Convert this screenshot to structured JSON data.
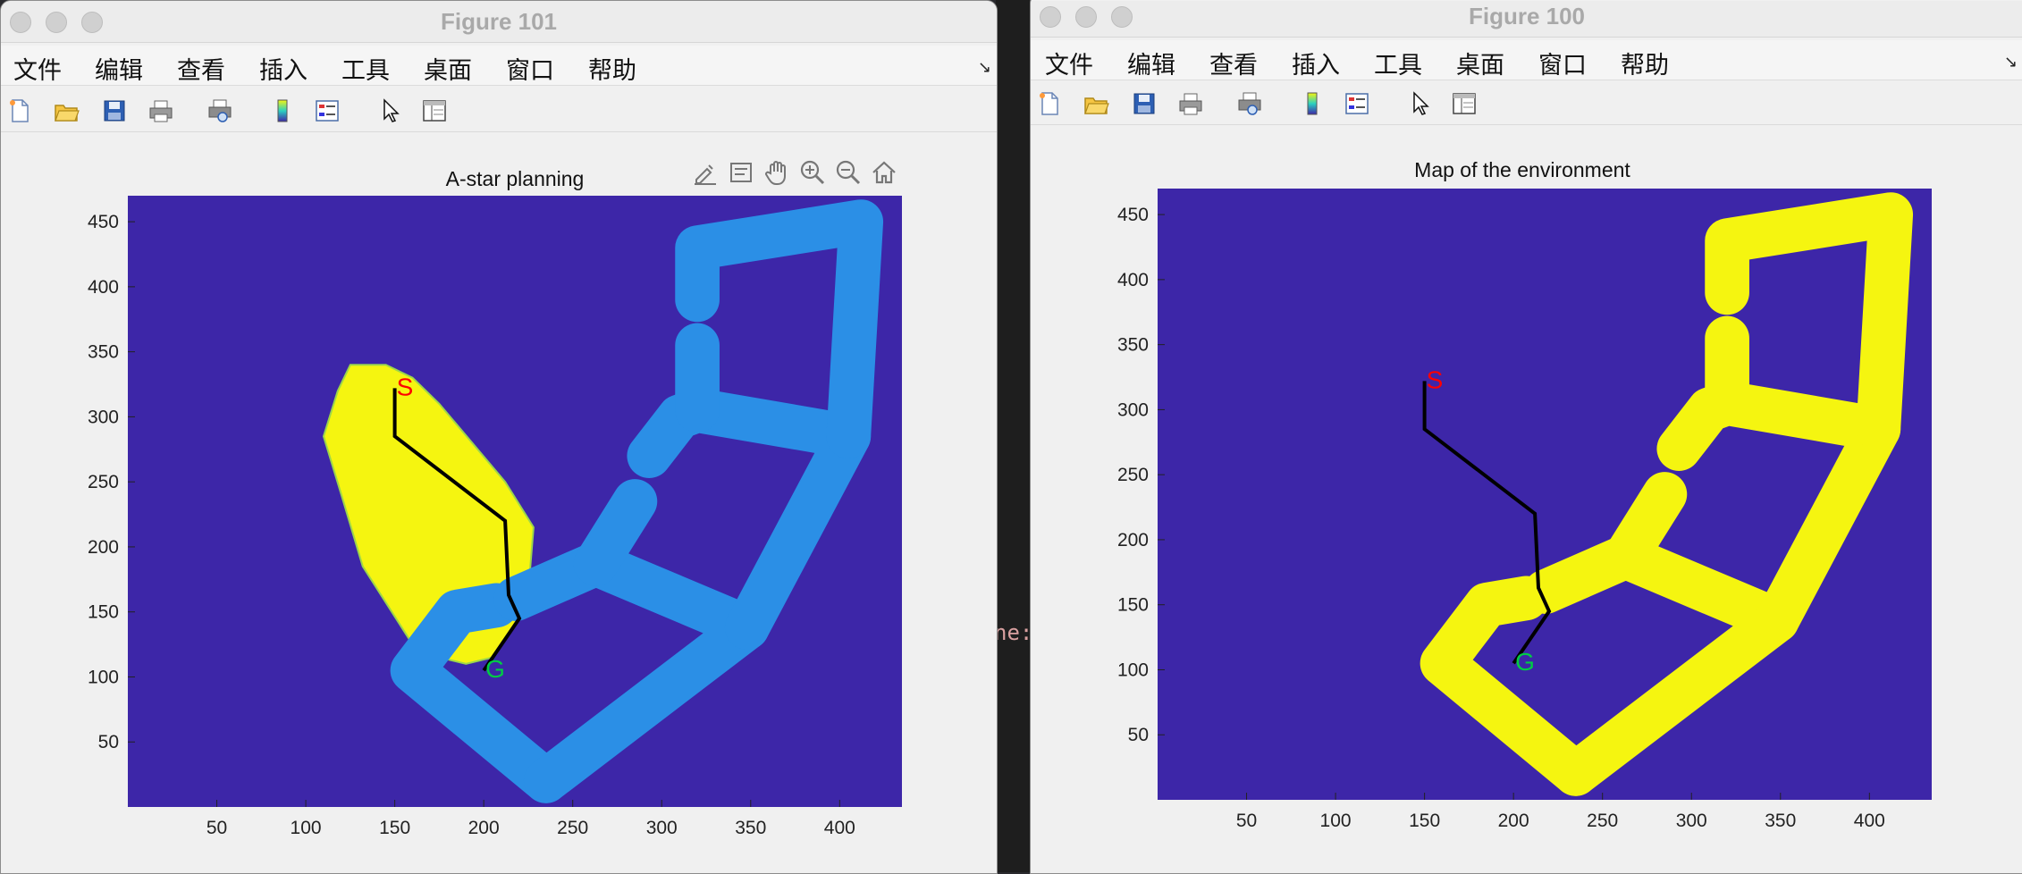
{
  "background": {
    "terminal_fragment": "ne:"
  },
  "windows": [
    {
      "id": "w101",
      "title": "Figure 101",
      "menu": [
        "文件",
        "编辑",
        "查看",
        "插入",
        "工具",
        "桌面",
        "窗口",
        "帮助"
      ],
      "chart_title": "A-star planning",
      "axes_tools": [
        "brush-icon",
        "datatip-icon",
        "pan-icon",
        "zoom-in-icon",
        "zoom-out-icon",
        "home-icon"
      ]
    },
    {
      "id": "w100",
      "title": "Figure 100",
      "menu": [
        "文件",
        "编辑",
        "查看",
        "插入",
        "工具",
        "桌面",
        "窗口",
        "帮助"
      ],
      "chart_title": "Map of the environment"
    }
  ],
  "toolbar_icons": [
    "new-file-icon",
    "open-folder-icon",
    "save-icon",
    "print-icon",
    "print-preview-icon",
    "colorbar-icon",
    "legend-icon",
    "pointer-icon",
    "property-inspector-icon"
  ],
  "chart_data": [
    {
      "type": "heatmap",
      "title": "A-star planning",
      "xlabel": "",
      "ylabel": "",
      "xlim": [
        0,
        435
      ],
      "ylim": [
        0,
        470
      ],
      "x_ticks": [
        50,
        100,
        150,
        200,
        250,
        300,
        350,
        400
      ],
      "y_ticks": [
        50,
        100,
        150,
        200,
        250,
        300,
        350,
        400,
        450
      ],
      "colors": {
        "free": "#3d26a8",
        "obstacle": "#2b8fe6",
        "explored": "#f5f510",
        "path": "#000000",
        "start_label": "#ff0000",
        "goal_label": "#00cc44"
      },
      "start": {
        "label": "S",
        "x": 150,
        "y": 322
      },
      "goal": {
        "label": "G",
        "x": 200,
        "y": 105
      },
      "path": [
        [
          150,
          322
        ],
        [
          150,
          285
        ],
        [
          212,
          220
        ],
        [
          214,
          163
        ],
        [
          220,
          145
        ],
        [
          200,
          105
        ]
      ],
      "obstacle_polyline": [
        [
          235,
          20
        ],
        [
          160,
          105
        ],
        [
          185,
          150
        ],
        [
          207,
          155
        ]
      ],
      "obstacle_polyline2": [
        [
          218,
          160
        ],
        [
          263,
          187
        ],
        [
          348,
          138
        ],
        [
          235,
          20
        ]
      ],
      "obstacle_polyline3": [
        [
          263,
          187
        ],
        [
          285,
          235
        ]
      ],
      "obstacle_polyline4": [
        [
          293,
          270
        ],
        [
          310,
          300
        ],
        [
          320,
          305
        ],
        [
          405,
          285
        ],
        [
          348,
          138
        ]
      ],
      "obstacle_polyline5": [
        [
          320,
          305
        ],
        [
          320,
          355
        ]
      ],
      "obstacle_polyline6": [
        [
          320,
          390
        ],
        [
          320,
          430
        ],
        [
          412,
          450
        ],
        [
          405,
          285
        ]
      ],
      "explored_region": [
        [
          118,
          320
        ],
        [
          125,
          340
        ],
        [
          145,
          340
        ],
        [
          160,
          330
        ],
        [
          175,
          310
        ],
        [
          212,
          250
        ],
        [
          228,
          215
        ],
        [
          225,
          165
        ],
        [
          218,
          140
        ],
        [
          205,
          115
        ],
        [
          190,
          110
        ],
        [
          175,
          115
        ],
        [
          160,
          125
        ],
        [
          132,
          185
        ],
        [
          120,
          240
        ],
        [
          110,
          285
        ]
      ]
    },
    {
      "type": "heatmap",
      "title": "Map of the environment",
      "xlabel": "",
      "ylabel": "",
      "xlim": [
        0,
        435
      ],
      "ylim": [
        0,
        470
      ],
      "x_ticks": [
        50,
        100,
        150,
        200,
        250,
        300,
        350,
        400
      ],
      "y_ticks": [
        50,
        100,
        150,
        200,
        250,
        300,
        350,
        400,
        450
      ],
      "colors": {
        "free": "#3d26a8",
        "obstacle": "#f5f510",
        "path": "#000000",
        "start_label": "#ff0000",
        "goal_label": "#00cc44"
      },
      "start": {
        "label": "S",
        "x": 150,
        "y": 322
      },
      "goal": {
        "label": "G",
        "x": 200,
        "y": 105
      },
      "path": [
        [
          150,
          322
        ],
        [
          150,
          285
        ],
        [
          212,
          220
        ],
        [
          214,
          163
        ],
        [
          220,
          145
        ],
        [
          200,
          105
        ]
      ]
    }
  ]
}
